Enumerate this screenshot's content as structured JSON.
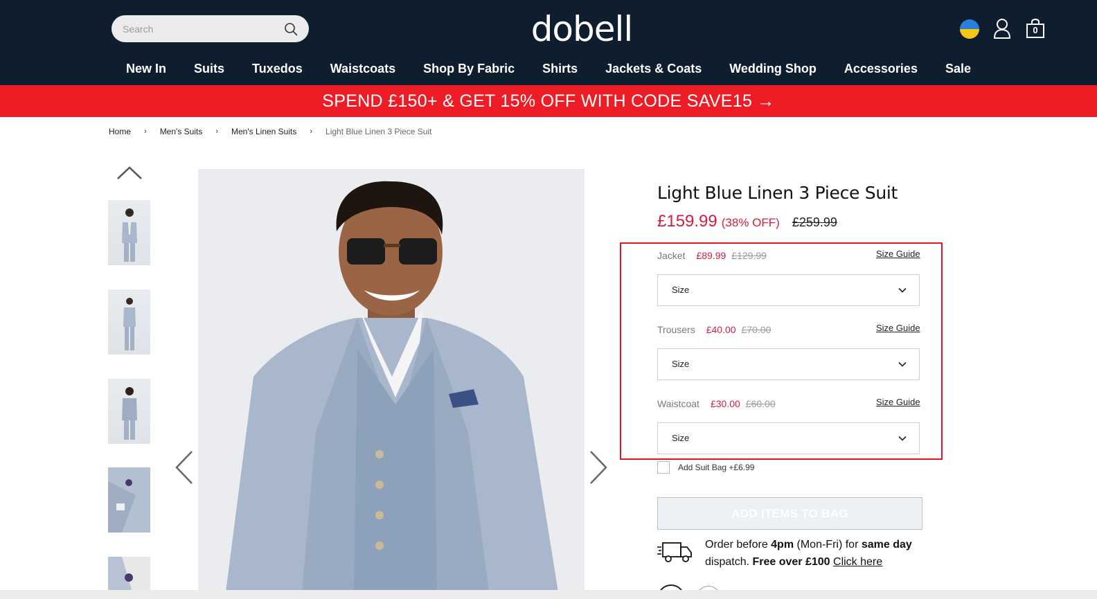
{
  "header": {
    "search_placeholder": "Search",
    "logo_text": "dobell",
    "bag_count": "0",
    "bg_color": "#0e1e2e"
  },
  "nav": {
    "items": [
      {
        "label": "New In"
      },
      {
        "label": "Suits"
      },
      {
        "label": "Tuxedos"
      },
      {
        "label": "Waistcoats"
      },
      {
        "label": "Shop By Fabric"
      },
      {
        "label": "Shirts"
      },
      {
        "label": "Jackets & Coats"
      },
      {
        "label": "Wedding Shop"
      },
      {
        "label": "Accessories"
      },
      {
        "label": "Sale"
      }
    ]
  },
  "promo": {
    "text": "SPEND £150+ & GET 15% OFF WITH CODE SAVE15 →",
    "color": "#ee1c25"
  },
  "breadcrumb": {
    "items": [
      {
        "label": "Home"
      },
      {
        "label": "Men's Suits"
      },
      {
        "label": "Men's Linen Suits"
      },
      {
        "label": "Light Blue Linen 3 Piece Suit"
      }
    ],
    "separator": "›"
  },
  "gallery": {
    "thumbnail_count": 5,
    "icons": [
      "chevron-up-icon",
      "chevron-left-icon",
      "chevron-right-icon"
    ]
  },
  "product": {
    "title": "Light Blue Linen 3 Piece Suit",
    "price_now": "£159.99",
    "price_discount": "(38% OFF)",
    "price_was": "£259.99",
    "accent_color": "#d31c43",
    "options": [
      {
        "name": "Jacket",
        "price": "£89.99",
        "was": "£129.99",
        "size_guide": "Size Guide",
        "select_label": "Size"
      },
      {
        "name": "Trousers",
        "price": "£40.00",
        "was": "£70.00",
        "size_guide": "Size Guide",
        "select_label": "Size"
      },
      {
        "name": "Waistcoat",
        "price": "£30.00",
        "was": "£60.00",
        "size_guide": "Size Guide",
        "select_label": "Size"
      }
    ],
    "suit_bag_label": "Add Suit Bag +£6.99",
    "add_button_label": "ADD ITEMS TO BAG"
  },
  "delivery": {
    "prefix": "Order before ",
    "time": "4pm",
    "middle": " (Mon-Fri) for ",
    "same_day": "same day",
    "dispatch": " dispatch. ",
    "free": "Free over £100",
    "space": " ",
    "link": "Click here"
  }
}
